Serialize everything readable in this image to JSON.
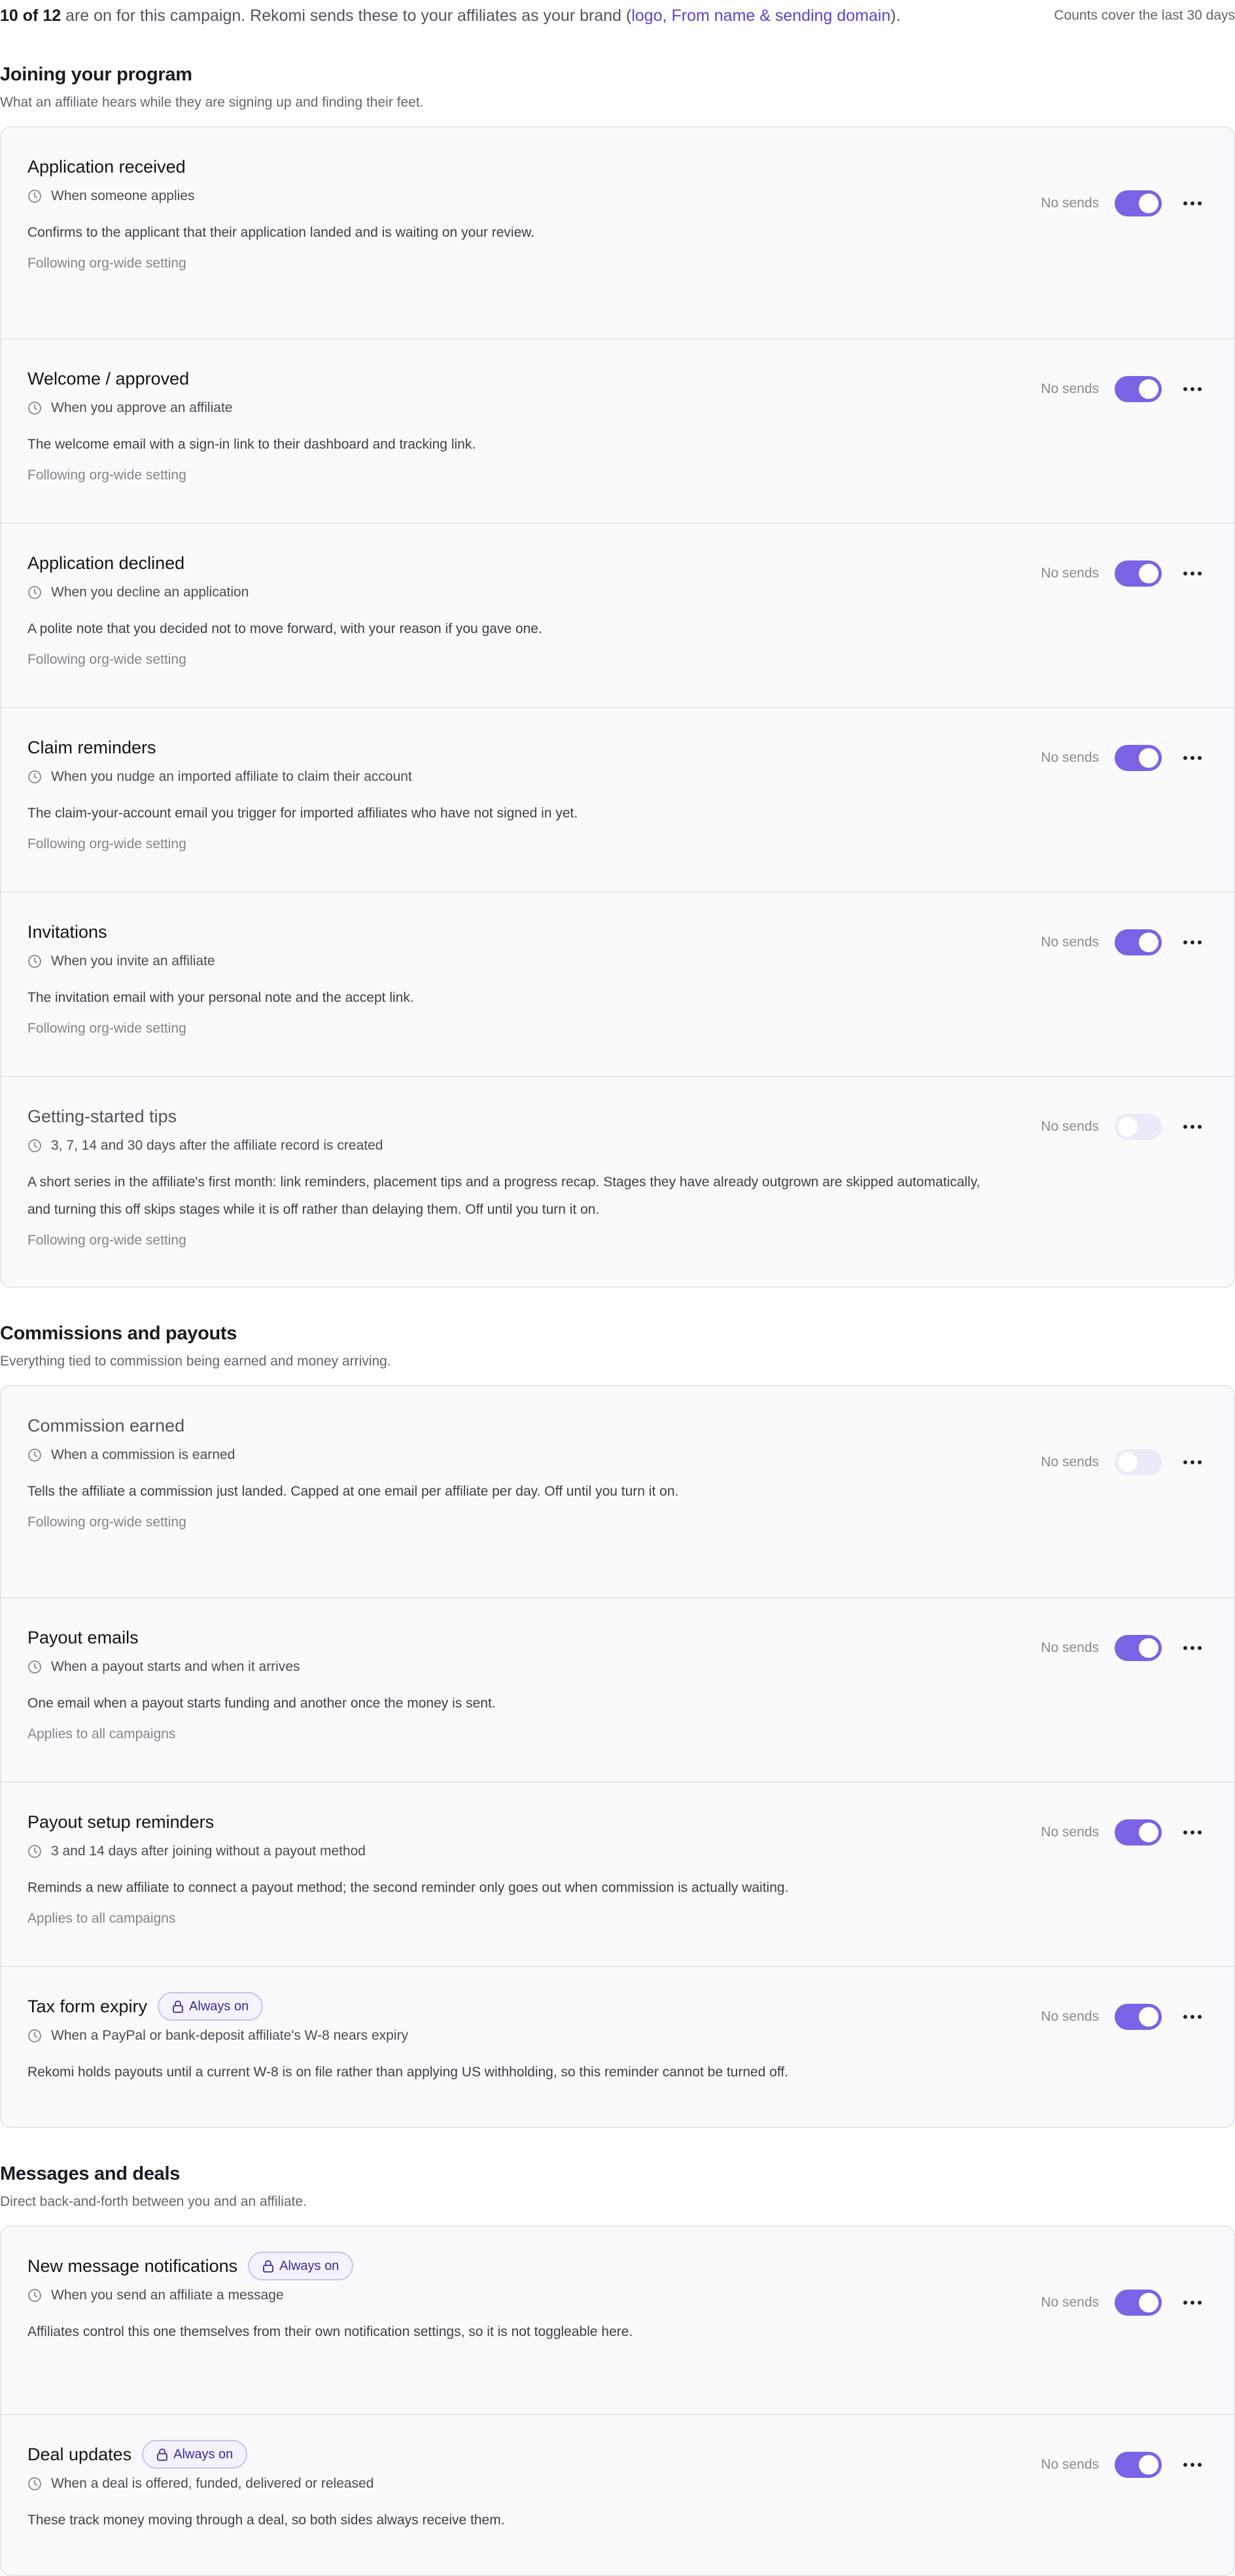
{
  "header": {
    "count_bold": "10 of 12",
    "intro_text": " are on for this campaign. Rekomi sends these to your affiliates as your brand (",
    "brand_link": "logo, From name & sending domain",
    "closing": ").",
    "window_note": "Counts cover the last 30 days"
  },
  "accent_color": "#7c62e5",
  "sections": [
    {
      "title": "Joining your program",
      "subtitle": "What an affiliate hears while they are signing up and finding their feet.",
      "items": [
        {
          "title": "Application received",
          "trigger": "When someone applies",
          "description": "Confirms to the applicant that their application landed and is waiting on your review.",
          "scope": "Following org-wide setting",
          "sends": "No sends",
          "enabled": true
        },
        {
          "title": "Welcome / approved",
          "trigger": "When you approve an affiliate",
          "description": "The welcome email with a sign-in link to their dashboard and tracking link.",
          "scope": "Following org-wide setting",
          "sends": "No sends",
          "enabled": true
        },
        {
          "title": "Application declined",
          "trigger": "When you decline an application",
          "description": "A polite note that you decided not to move forward, with your reason if you gave one.",
          "scope": "Following org-wide setting",
          "sends": "No sends",
          "enabled": true
        },
        {
          "title": "Claim reminders",
          "trigger": "When you nudge an imported affiliate to claim their account",
          "description": "The claim-your-account email you trigger for imported affiliates who have not signed in yet.",
          "scope": "Following org-wide setting",
          "sends": "No sends",
          "enabled": true
        },
        {
          "title": "Invitations",
          "trigger": "When you invite an affiliate",
          "description": "The invitation email with your personal note and the accept link.",
          "scope": "Following org-wide setting",
          "sends": "No sends",
          "enabled": true
        },
        {
          "title": "Getting-started tips",
          "trigger": "3, 7, 14 and 30 days after the affiliate record is created",
          "description": "A short series in the affiliate's first month: link reminders, placement tips and a progress recap. Stages they have already outgrown are skipped automatically, and turning this off skips stages while it is off rather than delaying them. Off until you turn it on.",
          "scope": "Following org-wide setting",
          "sends": "No sends",
          "enabled": false
        }
      ]
    },
    {
      "title": "Commissions and payouts",
      "subtitle": "Everything tied to commission being earned and money arriving.",
      "items": [
        {
          "title": "Commission earned",
          "trigger": "When a commission is earned",
          "description": "Tells the affiliate a commission just landed. Capped at one email per affiliate per day. Off until you turn it on.",
          "scope": "Following org-wide setting",
          "sends": "No sends",
          "enabled": false
        },
        {
          "title": "Payout emails",
          "trigger": "When a payout starts and when it arrives",
          "description": "One email when a payout starts funding and another once the money is sent.",
          "scope": "Applies to all campaigns",
          "sends": "No sends",
          "enabled": true
        },
        {
          "title": "Payout setup reminders",
          "trigger": "3 and 14 days after joining without a payout method",
          "description": "Reminds a new affiliate to connect a payout method; the second reminder only goes out when commission is actually waiting.",
          "scope": "Applies to all campaigns",
          "sends": "No sends",
          "enabled": true
        },
        {
          "title": "Tax form expiry",
          "badge": "Always on",
          "trigger": "When a PayPal or bank-deposit affiliate's W-8 nears expiry",
          "description": "Rekomi holds payouts until a current W-8 is on file rather than applying US withholding, so this reminder cannot be turned off.",
          "sends": "No sends",
          "enabled": true
        }
      ]
    },
    {
      "title": "Messages and deals",
      "subtitle": "Direct back-and-forth between you and an affiliate.",
      "items": [
        {
          "title": "New message notifications",
          "badge": "Always on",
          "trigger": "When you send an affiliate a message",
          "description": "Affiliates control this one themselves from their own notification settings, so it is not toggleable here.",
          "sends": "No sends",
          "enabled": true
        },
        {
          "title": "Deal updates",
          "badge": "Always on",
          "trigger": "When a deal is offered, funded, delivered or released",
          "description": "These track money moving through a deal, so both sides always receive them.",
          "sends": "No sends",
          "enabled": true
        }
      ]
    }
  ]
}
